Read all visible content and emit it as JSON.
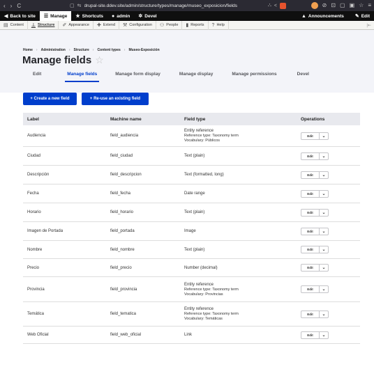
{
  "browser": {
    "back": "‹",
    "forward": "›",
    "reload": "C",
    "url": "drupal-site.ddev.site/admin/structure/types/manage/museo_exposicion/fields",
    "right_icons": [
      "⊘",
      "⊡",
      "▢",
      "▣",
      "☆",
      "≡"
    ]
  },
  "toolbar": {
    "back_to_site": "Back to site",
    "manage": "Manage",
    "shortcuts": "Shortcuts",
    "admin": "admin",
    "devel": "Devel",
    "announcements": "Announcements",
    "edit": "Edit"
  },
  "admin_menu": [
    "Content",
    "Structure",
    "Appearance",
    "Extend",
    "Configuration",
    "People",
    "Reports",
    "Help"
  ],
  "breadcrumb": [
    "Home",
    "Administration",
    "Structure",
    "Content types",
    "Museo-Exposición"
  ],
  "page": {
    "title": "Manage fields"
  },
  "tabs": [
    "Edit",
    "Manage fields",
    "Manage form display",
    "Manage display",
    "Manage permissions",
    "Devel"
  ],
  "buttons": {
    "create": "+ Create a new field",
    "reuse": "+ Re-use an existing field"
  },
  "table": {
    "headers": [
      "Label",
      "Machine name",
      "Field type",
      "Operations"
    ],
    "rows": [
      {
        "label": "Audiencia",
        "machine": "field_audiencia",
        "type": "Entity reference",
        "ref": "Reference type: Taxonomy term",
        "vocab": "Vocabulary: Públicos"
      },
      {
        "label": "Ciudad",
        "machine": "field_ciudad",
        "type": "Text (plain)"
      },
      {
        "label": "Descripción",
        "machine": "field_descripcion",
        "type": "Text (formatted, long)"
      },
      {
        "label": "Fecha",
        "machine": "field_fecha",
        "type": "Date range"
      },
      {
        "label": "Horario",
        "machine": "field_horario",
        "type": "Text (plain)"
      },
      {
        "label": "Imagen de Portada",
        "machine": "field_portada",
        "type": "Image"
      },
      {
        "label": "Nombre",
        "machine": "field_nombre",
        "type": "Text (plain)"
      },
      {
        "label": "Precio",
        "machine": "field_precio",
        "type": "Number (decimal)"
      },
      {
        "label": "Provincia",
        "machine": "field_provincia",
        "type": "Entity reference",
        "ref": "Reference type: Taxonomy term",
        "vocab": "Vocabulary: Provincias"
      },
      {
        "label": "Temática",
        "machine": "field_tematica",
        "type": "Entity reference",
        "ref": "Reference type: Taxonomy term",
        "vocab": "Vocabulary: Temáticas"
      },
      {
        "label": "Web Oficial",
        "machine": "field_web_oficial",
        "type": "Link"
      }
    ],
    "edit_label": "Edit"
  }
}
